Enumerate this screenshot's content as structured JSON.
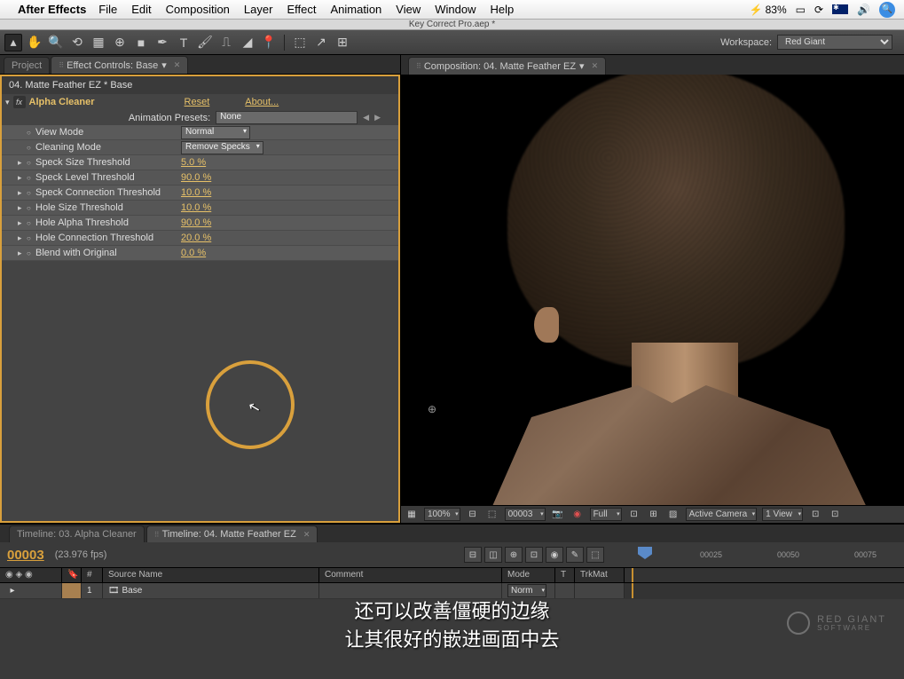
{
  "mac": {
    "app": "After Effects",
    "menus": [
      "File",
      "Edit",
      "Composition",
      "Layer",
      "Effect",
      "Animation",
      "View",
      "Window",
      "Help"
    ],
    "battery": "83%"
  },
  "window_title": "Key Correct Pro.aep *",
  "workspace": {
    "label": "Workspace:",
    "value": "Red Giant"
  },
  "tabs": {
    "project": "Project",
    "effect_controls": "Effect Controls: Base",
    "composition": "Composition: 04. Matte Feather EZ"
  },
  "effect": {
    "breadcrumb": "04. Matte Feather EZ * Base",
    "name": "Alpha Cleaner",
    "reset": "Reset",
    "about": "About...",
    "presets_label": "Animation Presets:",
    "presets_value": "None",
    "params": [
      {
        "label": "View Mode",
        "type": "drop",
        "value": "Normal"
      },
      {
        "label": "Cleaning Mode",
        "type": "drop",
        "value": "Remove Specks"
      },
      {
        "label": "Speck Size Threshold",
        "type": "val",
        "value": "5.0 %"
      },
      {
        "label": "Speck Level Threshold",
        "type": "val",
        "value": "90.0 %"
      },
      {
        "label": "Speck Connection Threshold",
        "type": "val",
        "value": "10.0 %"
      },
      {
        "label": "Hole Size Threshold",
        "type": "val",
        "value": "10.0 %"
      },
      {
        "label": "Hole Alpha Threshold",
        "type": "val",
        "value": "90.0 %"
      },
      {
        "label": "Hole Connection Threshold",
        "type": "val",
        "value": "20.0 %"
      },
      {
        "label": "Blend with Original",
        "type": "val",
        "value": "0.0 %"
      }
    ]
  },
  "viewer": {
    "zoom": "100%",
    "frame": "00003",
    "res": "Full",
    "camera": "Active Camera",
    "views": "1 View"
  },
  "timeline": {
    "tabs": [
      "Timeline: 03. Alpha Cleaner",
      "Timeline: 04. Matte Feather EZ"
    ],
    "time": "00003",
    "fps": "(23.976 fps)",
    "ruler": [
      "00025",
      "00050",
      "00075"
    ],
    "cols": {
      "num": "#",
      "source": "Source Name",
      "comment": "Comment",
      "mode": "Mode",
      "t": "T",
      "trkmat": "TrkMat"
    },
    "layer": {
      "index": "1",
      "name": "Base",
      "mode": "Norm"
    }
  },
  "subtitle": "还可以改善僵硬的边缘\n让其很好的嵌进画面中去",
  "watermark": {
    "brand": "RED GIANT",
    "sub": "SOFTWARE"
  }
}
